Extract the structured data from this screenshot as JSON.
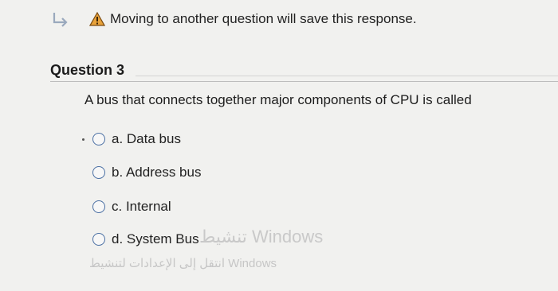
{
  "notice": {
    "text": "Moving to another question will save this response.",
    "return_icon": "return-arrow-icon",
    "warning_icon": "warning-icon"
  },
  "question": {
    "title": "Question 3",
    "text": "A bus that connects together major components of CPU is called",
    "options": [
      {
        "label": "a. Data bus",
        "selected": false
      },
      {
        "label": "b. Address bus",
        "selected": false
      },
      {
        "label": "c. Internal",
        "selected": false
      },
      {
        "label": "d. System Bus",
        "selected": false
      }
    ]
  },
  "watermark": {
    "line1": "تنشيط Windows",
    "line2": "انتقل إلى الإعدادات لتنشيط Windows"
  },
  "colors": {
    "radio_border": "#4a6fa3",
    "warning_fill": "#e8a23a",
    "watermark": "#c8c8c8"
  }
}
